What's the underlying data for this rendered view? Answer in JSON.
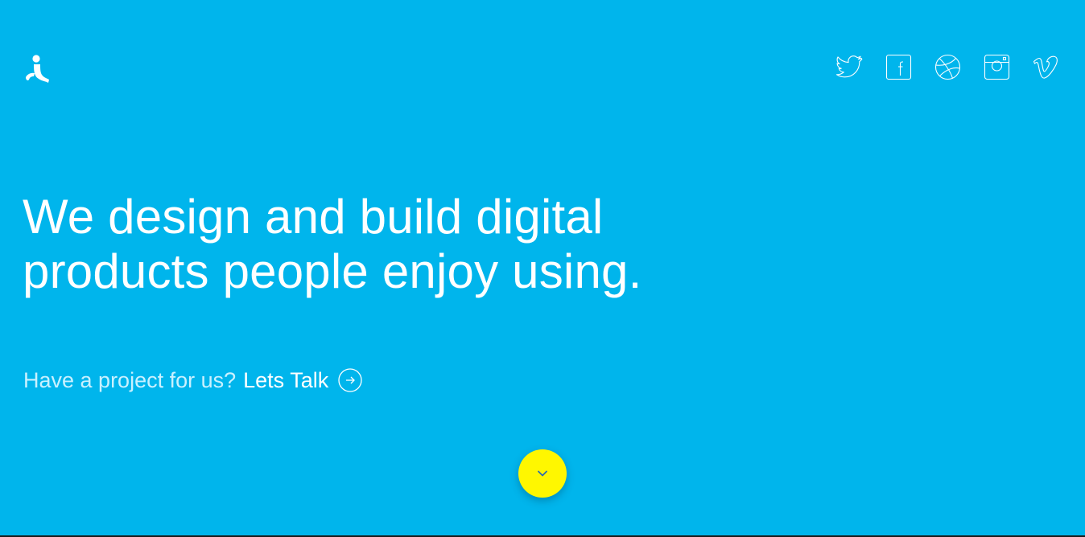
{
  "header": {
    "logo_icon": "person-logo-icon",
    "social": [
      {
        "name": "twitter",
        "icon": "twitter-icon"
      },
      {
        "name": "facebook",
        "icon": "facebook-icon"
      },
      {
        "name": "dribbble",
        "icon": "dribbble-icon"
      },
      {
        "name": "instagram",
        "icon": "instagram-icon"
      },
      {
        "name": "vimeo",
        "icon": "vimeo-icon"
      }
    ]
  },
  "hero": {
    "line1": "We design and build digital",
    "line2": "products people enjoy using."
  },
  "cta": {
    "question": "Have a project for us?",
    "link_label": "Lets Talk",
    "arrow_icon": "arrow-right-circle-icon"
  },
  "scroll": {
    "icon": "chevron-down-icon"
  },
  "colors": {
    "background": "#00b5ec",
    "text": "#ffffff",
    "muted_text": "#c9f1ff",
    "scroll_button": "#fff700",
    "chevron": "#2d6bb0"
  }
}
